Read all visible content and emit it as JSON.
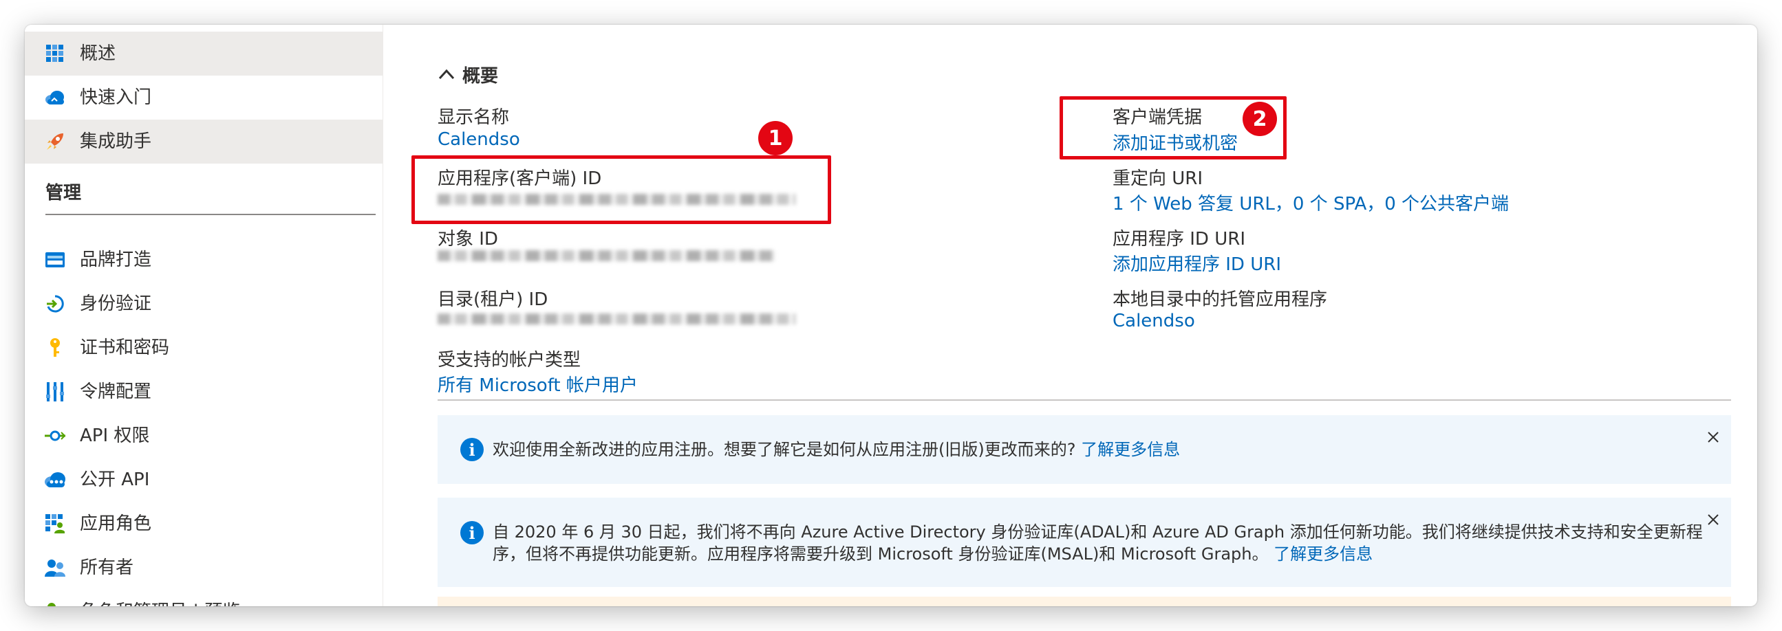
{
  "sidebar": {
    "items": [
      {
        "label": "概述",
        "icon": "grid-icon",
        "active": true
      },
      {
        "label": "快速入门",
        "icon": "cloud-icon"
      },
      {
        "label": "集成助手",
        "icon": "rocket-icon",
        "active": true
      }
    ],
    "section_header": "管理",
    "manage_items": [
      {
        "label": "品牌打造",
        "icon": "branding-icon"
      },
      {
        "label": "身份验证",
        "icon": "authentication-icon"
      },
      {
        "label": "证书和密码",
        "icon": "key-icon"
      },
      {
        "label": "令牌配置",
        "icon": "token-icon"
      },
      {
        "label": "API 权限",
        "icon": "api-permissions-icon"
      },
      {
        "label": "公开 API",
        "icon": "cloud-api-icon"
      },
      {
        "label": "应用角色",
        "icon": "app-roles-icon"
      },
      {
        "label": "所有者",
        "icon": "owners-icon"
      },
      {
        "label": "角色和管理员 | 预览",
        "icon": "roles-admins-icon"
      }
    ]
  },
  "essentials": {
    "toggle_label": "概要",
    "left": {
      "display_name_label": "显示名称",
      "display_name_value": "Calendso",
      "client_id_label": "应用程序(客户端) ID",
      "object_id_label": "对象 ID",
      "tenant_id_label": "目录(租户) ID",
      "account_types_label": "受支持的帐户类型",
      "account_types_value": "所有 Microsoft 帐户用户"
    },
    "right": {
      "credentials_label": "客户端凭据",
      "credentials_value": "添加证书或机密",
      "redirect_label": "重定向 URI",
      "redirect_value": "1 个 Web 答复 URL，0 个 SPA，0 个公共客户端",
      "app_id_uri_label": "应用程序 ID URI",
      "app_id_uri_value": "添加应用程序 ID URI",
      "managed_app_label": "本地目录中的托管应用程序",
      "managed_app_value": "Calendso"
    }
  },
  "annotations": {
    "badge_1": "1",
    "badge_2": "2"
  },
  "banners": [
    {
      "text": "欢迎使用全新改进的应用注册。想要了解它是如何从应用注册(旧版)更改而来的?",
      "link": "了解更多信息"
    },
    {
      "text_line1": "自 2020 年 6 月 30 日起，我们将不再向 Azure Active Directory 身份验证库(ADAL)和 Azure AD Graph 添加任何新功能。我们将继续提供技术支持和安全更新程",
      "text_line2": "序，但将不再提供功能更新。应用程序将需要升级到 Microsoft 身份验证库(MSAL)和 Microsoft Graph。",
      "link": "了解更多信息"
    }
  ],
  "colors": {
    "link": "#0067b8",
    "annotation_red": "#e30613",
    "banner_bg": "#eff6fc",
    "info_blue": "#0078d4"
  }
}
